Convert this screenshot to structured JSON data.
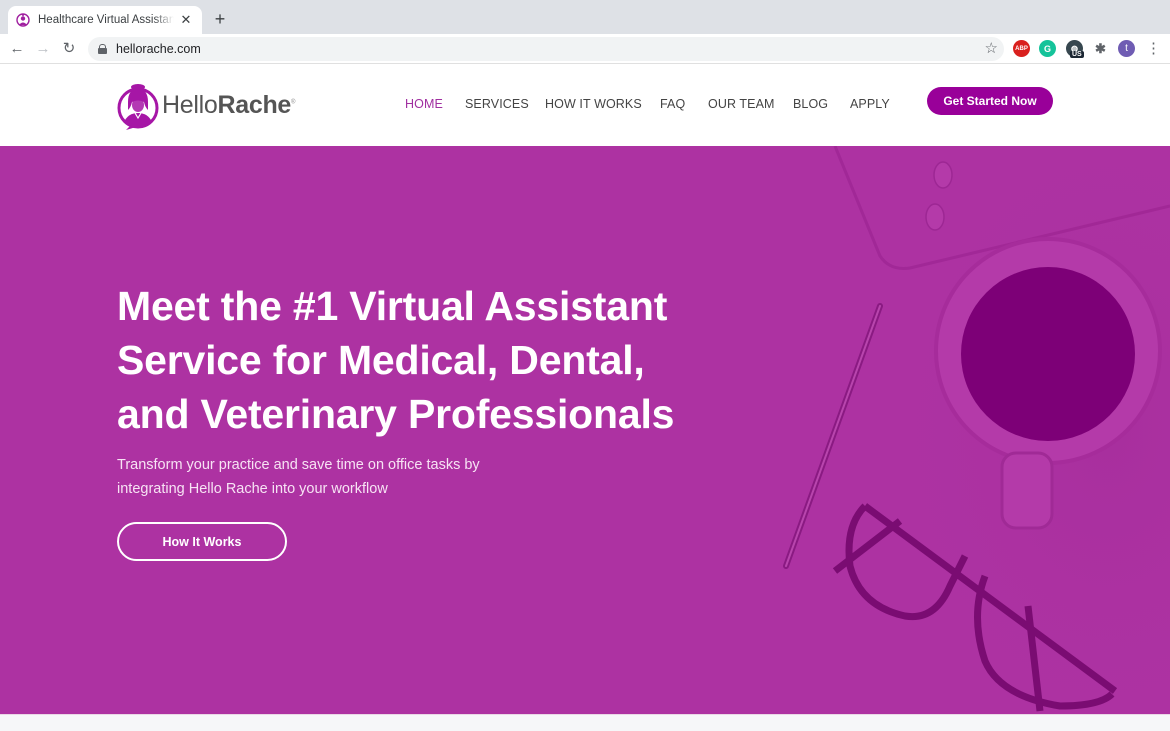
{
  "browser": {
    "tab": {
      "title": "Healthcare Virtual Assistants F",
      "favicon": "hellorache-favicon"
    },
    "new_tab_label": "+",
    "close_tab_label": "✕",
    "url": "hellorache.com",
    "back_icon": "←",
    "forward_icon": "→",
    "reload_icon": "↻",
    "star_icon": "☆",
    "extensions": [
      {
        "name": "adblock-plus",
        "label": "ABP"
      },
      {
        "name": "grammarly",
        "label": "G"
      },
      {
        "name": "vpn",
        "label": "◍",
        "badge": "US"
      },
      {
        "name": "extensions-puzzle",
        "label": "✱"
      }
    ],
    "profile_initial": "t",
    "menu_icon": "⋮"
  },
  "site": {
    "brand": {
      "name_light": "Hello",
      "name_bold": "Rache",
      "trademark": "®"
    },
    "nav": [
      {
        "label": "HOME",
        "active": true
      },
      {
        "label": "SERVICES",
        "active": false
      },
      {
        "label": "HOW IT WORKS",
        "active": false
      },
      {
        "label": "FAQ",
        "active": false
      },
      {
        "label": "OUR TEAM",
        "active": false
      },
      {
        "label": "BLOG",
        "active": false
      },
      {
        "label": "APPLY",
        "active": false
      }
    ],
    "cta_label": "Get Started Now",
    "colors": {
      "brand": "#990099",
      "hero_bg": "#ad32a2",
      "nav_active": "#a02fa0"
    }
  },
  "hero": {
    "title_lines": [
      "Meet the #1 Virtual Assistant",
      "Service for Medical, Dental,",
      "and Veterinary Professionals"
    ],
    "subtitle_lines": [
      "Transform your practice and save time on office tasks by",
      "integrating Hello Rache into your workflow"
    ],
    "button_label": "How It Works"
  }
}
